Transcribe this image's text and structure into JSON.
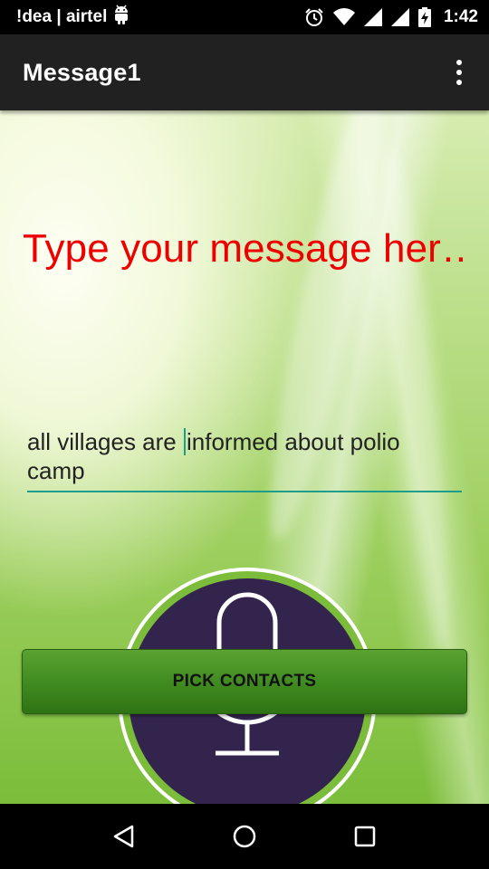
{
  "status_bar": {
    "carrier": "!dea | airtel",
    "time": "1:42",
    "icons": [
      "android-icon",
      "alarm-icon",
      "wifi-icon",
      "signal-icon",
      "signal-icon",
      "battery-charging-icon"
    ]
  },
  "app_bar": {
    "title": "Message1",
    "overflow_icon": "more-vert-icon"
  },
  "main": {
    "heading": "Type your message her…",
    "message_before_cursor": "all villages are ",
    "message_after_cursor": "informed about polio camp",
    "mic_icon": "microphone-icon",
    "pick_contacts_label": "PICK CONTACTS"
  },
  "nav_bar": {
    "icons": [
      "back-icon",
      "home-icon",
      "recents-icon"
    ]
  },
  "colors": {
    "status_bar_bg": "#000000",
    "app_bar_bg": "#212121",
    "heading_text": "#ee0000",
    "field_underline": "#1e9e8a",
    "mic_bg": "#33244d",
    "button_green": "#3f8a1f"
  }
}
